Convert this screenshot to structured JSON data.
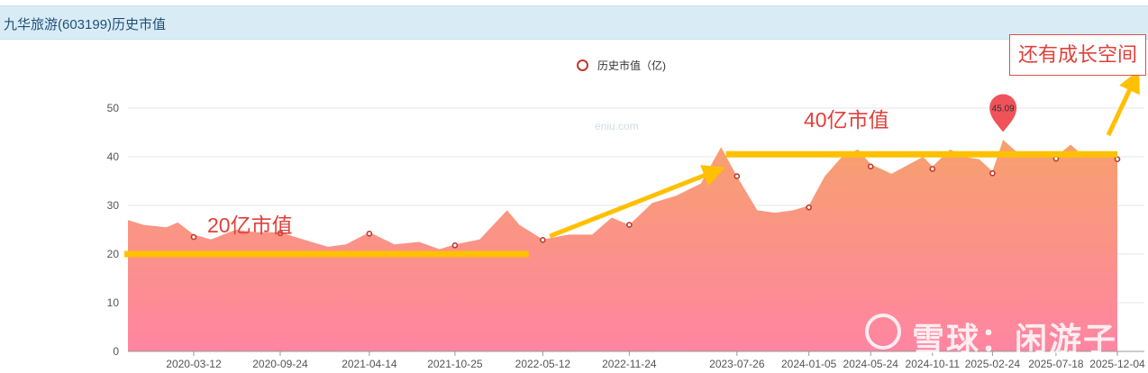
{
  "header": {
    "title": "九华旅游(603199)历史市值"
  },
  "legend": {
    "label": "历史市值（亿)"
  },
  "colors": {
    "area_top": "#f7a06e",
    "area_bottom": "#ff85a2",
    "marker": "#c0392b",
    "annotation": "#e0403a",
    "highlight_line": "#ffc000",
    "pin": "#f0525a"
  },
  "chart_data": {
    "type": "area",
    "title": "九华旅游(603199)历史市值",
    "ylim": [
      0,
      50
    ],
    "yticks": [
      0,
      10,
      20,
      30,
      40,
      50
    ],
    "xticks": [
      "2020-03-12",
      "2020-09-24",
      "2021-04-14",
      "2021-10-25",
      "2022-05-12",
      "2022-11-24",
      "2023-07-26",
      "2024-01-05",
      "2024-05-24",
      "2024-10-11",
      "2025-02-24",
      "2025-07-18",
      "2025-12-04"
    ],
    "series": [
      {
        "name": "历史市值（亿)",
        "x": [
          "2019-10-15",
          "2019-11-20",
          "2020-01-10",
          "2020-02-05",
          "2020-03-12",
          "2020-04-20",
          "2020-06-15",
          "2020-08-01",
          "2020-09-24",
          "2020-11-15",
          "2021-01-10",
          "2021-02-20",
          "2021-04-14",
          "2021-06-10",
          "2021-08-05",
          "2021-09-20",
          "2021-10-25",
          "2021-12-20",
          "2022-02-20",
          "2022-03-20",
          "2022-05-12",
          "2022-07-10",
          "2022-09-01",
          "2022-10-15",
          "2022-11-24",
          "2023-01-15",
          "2023-03-10",
          "2023-05-05",
          "2023-06-20",
          "2023-07-26",
          "2023-09-10",
          "2023-10-20",
          "2023-12-01",
          "2024-01-05",
          "2024-02-10",
          "2024-03-20",
          "2024-04-25",
          "2024-05-24",
          "2024-07-10",
          "2024-08-20",
          "2024-09-20",
          "2024-10-11",
          "2024-11-20",
          "2024-12-20",
          "2025-01-25",
          "2025-02-24",
          "2025-03-20",
          "2025-04-20",
          "2025-05-20",
          "2025-06-20",
          "2025-07-18",
          "2025-08-20",
          "2025-09-20",
          "2025-10-25",
          "2025-12-04"
        ],
        "values": [
          27,
          26,
          25.5,
          26.5,
          24,
          23,
          25,
          24.5,
          24.5,
          23,
          21.5,
          22,
          24.5,
          22,
          22.5,
          21,
          22,
          23,
          29,
          26,
          23,
          24,
          24,
          27.5,
          26,
          30.5,
          32,
          34.5,
          42,
          36,
          29,
          28.5,
          29,
          30,
          36,
          40,
          41.5,
          38.5,
          36.5,
          38.5,
          40,
          38,
          41.5,
          40,
          39.5,
          37,
          43.5,
          41,
          40.5,
          40.5,
          40,
          42.5,
          40,
          40,
          40
        ]
      }
    ],
    "markers": [
      {
        "x": "2020-03-12",
        "value": 23.5
      },
      {
        "x": "2020-09-24",
        "value": 24.3
      },
      {
        "x": "2021-04-14",
        "value": 24.2
      },
      {
        "x": "2021-10-25",
        "value": 21.8
      },
      {
        "x": "2022-05-12",
        "value": 22.9
      },
      {
        "x": "2022-11-24",
        "value": 26.0
      },
      {
        "x": "2023-07-26",
        "value": 36.0
      },
      {
        "x": "2024-01-05",
        "value": 29.6
      },
      {
        "x": "2024-05-24",
        "value": 38.0
      },
      {
        "x": "2024-10-11",
        "value": 37.5
      },
      {
        "x": "2025-02-24",
        "value": 36.6
      },
      {
        "x": "2025-07-18",
        "value": 39.6
      },
      {
        "x": "2025-12-04",
        "value": 39.5
      }
    ],
    "max_point": {
      "x": "2025-03-20",
      "value": 45.09,
      "label": "45.09"
    },
    "watermark_site": "eniu.com",
    "annotations": {
      "level_20": {
        "label": "20亿市值",
        "value": 20
      },
      "level_40": {
        "label": "40亿市值",
        "value": 40.5
      },
      "callout": "还有成长空间"
    },
    "grid": true,
    "legend_position": "top-center"
  },
  "watermark": {
    "text": "雪球：闲游子"
  }
}
